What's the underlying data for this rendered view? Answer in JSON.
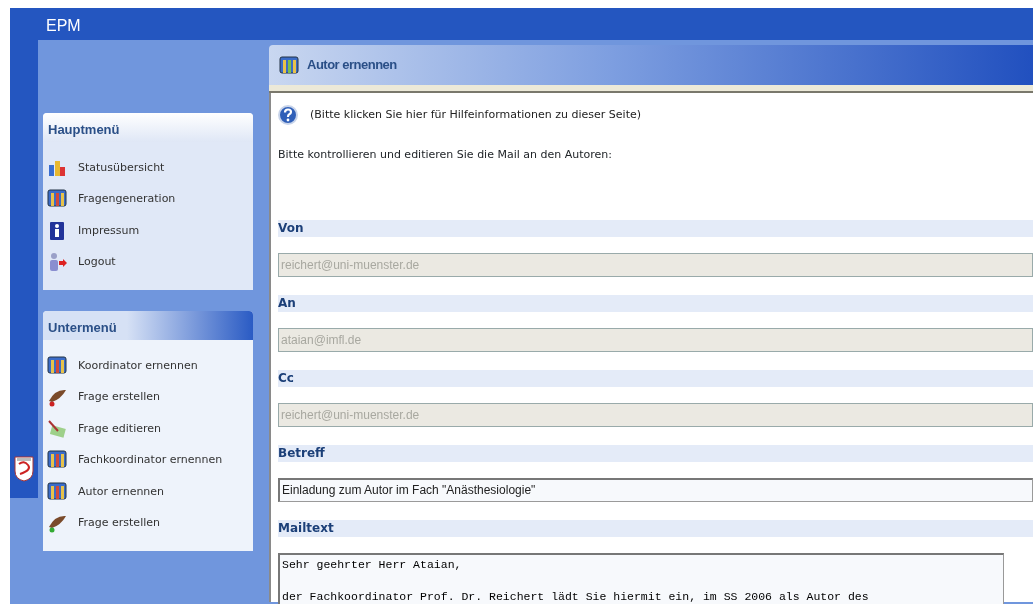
{
  "app": {
    "title": "EPM"
  },
  "menus": [
    {
      "title": "Hauptmenü",
      "items": [
        {
          "label": "Statusübersicht"
        },
        {
          "label": "Fragengeneration"
        },
        {
          "label": "Impressum"
        },
        {
          "label": "Logout"
        }
      ]
    },
    {
      "title": "Untermenü",
      "items": [
        {
          "label": "Koordinator ernennen"
        },
        {
          "label": "Frage erstellen"
        },
        {
          "label": "Frage editieren"
        },
        {
          "label": "Fachkoordinator ernennen"
        },
        {
          "label": "Autor ernennen"
        },
        {
          "label": "Frage erstellen"
        }
      ]
    }
  ],
  "panel": {
    "title": "Autor ernennen",
    "help": "(Bitte klicken Sie hier für Hilfeinformationen zu dieser Seite)",
    "intro": "Bitte kontrollieren und editieren Sie die Mail an den Autoren:",
    "fields": [
      {
        "label": "Von",
        "kind": "input",
        "value": "reichert@uni-muenster.de",
        "disabled": true
      },
      {
        "label": "An",
        "kind": "input",
        "value": "ataian@imfl.de",
        "disabled": true
      },
      {
        "label": "Cc",
        "kind": "input",
        "value": "reichert@uni-muenster.de",
        "disabled": true
      },
      {
        "label": "Betreff",
        "kind": "input",
        "value": "Einladung zum Autor im Fach \"Anästhesiologie\"",
        "disabled": false
      },
      {
        "label": "Mailtext",
        "kind": "textarea",
        "value": "Sehr geehrter Herr Ataian,\n\nder Fachkoordinator Prof. Dr. Reichert lädt Sie hiermit ein, im SS 2006 als Autor des",
        "disabled": false
      }
    ]
  }
}
